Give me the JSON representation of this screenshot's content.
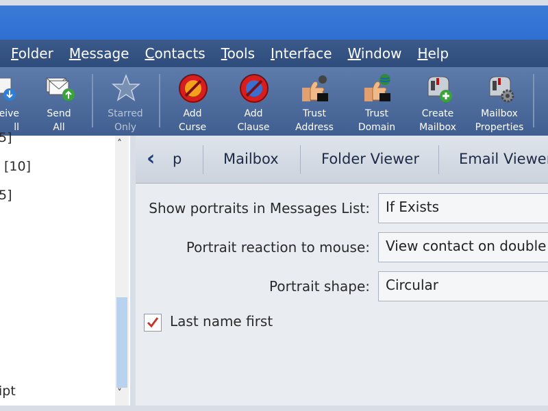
{
  "menubar": {
    "items": [
      {
        "first": "F",
        "rest": "older"
      },
      {
        "first": "M",
        "rest": "essage"
      },
      {
        "first": "C",
        "rest": "ontacts"
      },
      {
        "first": "T",
        "rest": "ools"
      },
      {
        "first": "I",
        "rest": "nterface"
      },
      {
        "first": "W",
        "rest": "indow"
      },
      {
        "first": "H",
        "rest": "elp"
      }
    ]
  },
  "toolbar": {
    "buttons": [
      {
        "line1": "eive",
        "line2": "ll",
        "icon": "receive-all-icon"
      },
      {
        "line1": "Send",
        "line2": "All",
        "icon": "send-all-icon"
      },
      {
        "line1": "Starred",
        "line2": "Only",
        "icon": "star-icon"
      },
      {
        "line1": "Add",
        "line2": "Curse",
        "icon": "add-curse-icon"
      },
      {
        "line1": "Add",
        "line2": "Clause",
        "icon": "add-clause-icon"
      },
      {
        "line1": "Trust",
        "line2": "Address",
        "icon": "trust-address-icon"
      },
      {
        "line1": "Trust",
        "line2": "Domain",
        "icon": "trust-domain-icon"
      },
      {
        "line1": "Create",
        "line2": "Mailbox",
        "icon": "create-mailbox-icon"
      },
      {
        "line1": "Mailbox",
        "line2": "Properties",
        "icon": "mailbox-properties-icon"
      }
    ]
  },
  "tree": {
    "rows": [
      "5]",
      "[10]",
      "5]",
      "ipt"
    ]
  },
  "tabs": {
    "back_label": "p",
    "items": [
      "Mailbox",
      "Folder Viewer",
      "Email Viewer"
    ]
  },
  "settings": {
    "portraits_label": "Show portraits in Messages List:",
    "portraits_value": "If Exists",
    "reaction_label": "Portrait reaction to mouse:",
    "reaction_value": "View contact on double",
    "shape_label": "Portrait shape:",
    "shape_value": "Circular",
    "last_name_first_label": "Last name first",
    "last_name_first_checked": true
  },
  "colors": {
    "accent": "#2f6fd2",
    "check": "#c0392b"
  }
}
